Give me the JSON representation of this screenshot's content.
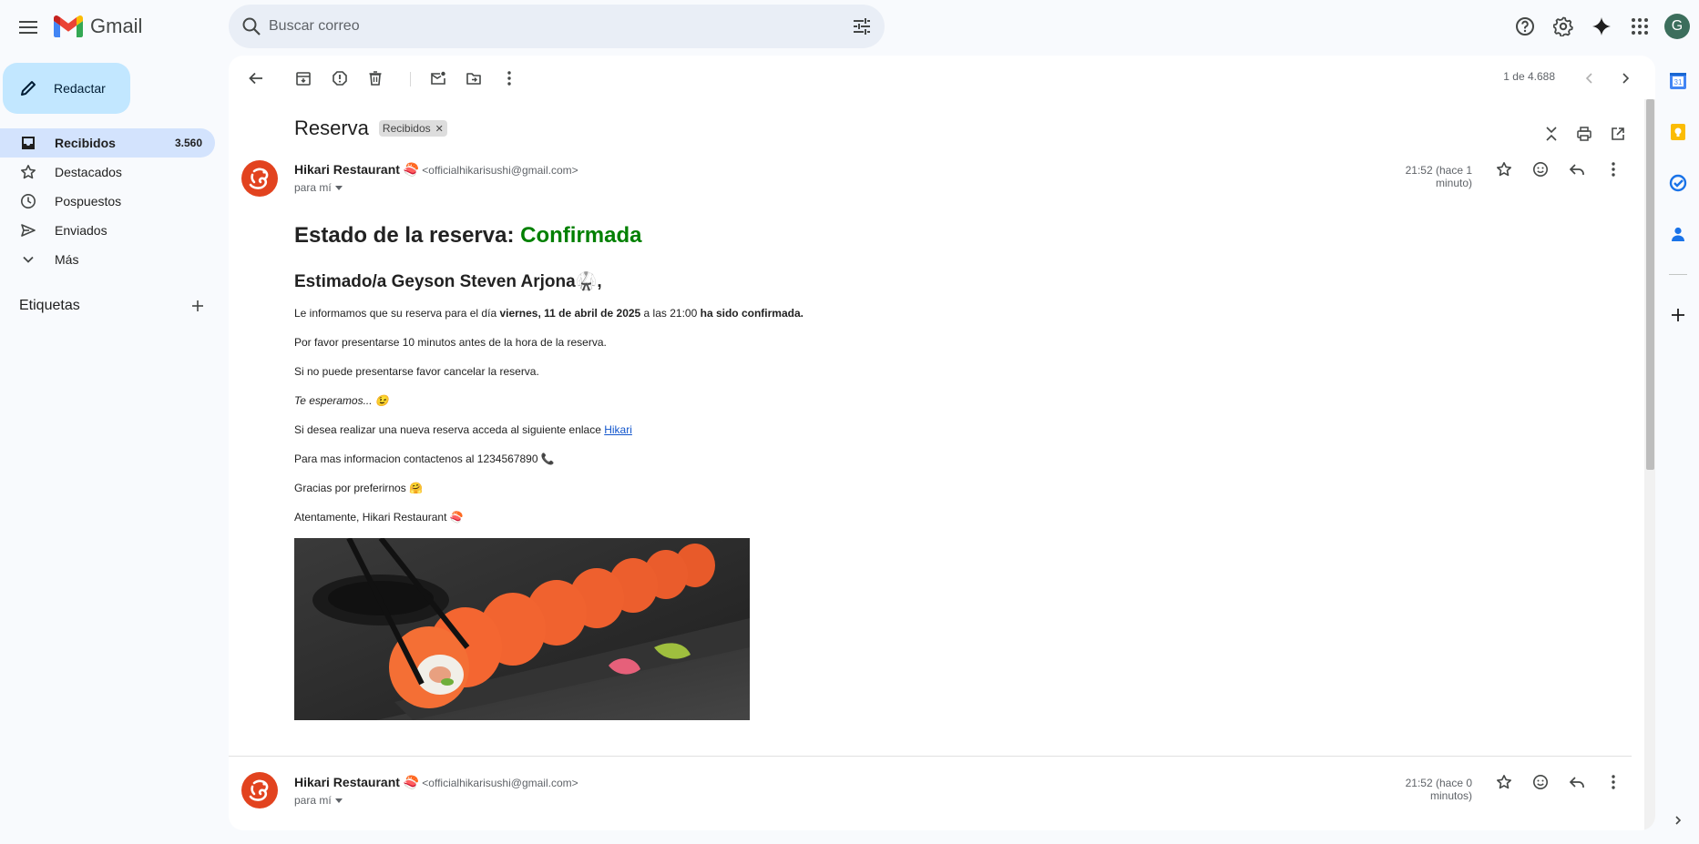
{
  "app": {
    "name": "Gmail"
  },
  "search": {
    "placeholder": "Buscar correo"
  },
  "header": {
    "avatar_letter": "G"
  },
  "compose": {
    "label": "Redactar"
  },
  "nav": {
    "items": [
      {
        "label": "Recibidos",
        "count": "3.560",
        "icon": "inbox-icon"
      },
      {
        "label": "Destacados",
        "count": "",
        "icon": "star-icon"
      },
      {
        "label": "Pospuestos",
        "count": "",
        "icon": "clock-icon"
      },
      {
        "label": "Enviados",
        "count": "",
        "icon": "send-icon"
      },
      {
        "label": "Más",
        "count": "",
        "icon": "chevron-down-icon"
      }
    ],
    "labels_title": "Etiquetas"
  },
  "toolbar": {
    "pager": "1 de 4.688"
  },
  "thread": {
    "subject": "Reserva",
    "chip": "Recibidos",
    "messages": [
      {
        "sender_name": "Hikari Restaurant 🍣",
        "sender_email": "<officialhikarisushi@gmail.com>",
        "to": "para mí",
        "time": "21:52 (hace 1 minuto)"
      },
      {
        "sender_name": "Hikari Restaurant 🍣",
        "sender_email": "<officialhikarisushi@gmail.com>",
        "to": "para mí",
        "time": "21:52 (hace 0 minutos)"
      }
    ]
  },
  "email": {
    "title_prefix": "Estado de la reserva: ",
    "title_status": "Confirmada",
    "greeting": "Estimado/a Geyson Steven Arjona🥋,",
    "p1_pre": "Le informamos que su reserva para el día ",
    "p1_date": "viernes, 11 de abril de 2025",
    "p1_mid": " a las 21:00 ",
    "p1_post": "ha sido confirmada.",
    "p2": "Por favor presentarse 10 minutos antes de la hora de la reserva.",
    "p3": "Si no puede presentarse favor cancelar la reserva.",
    "p4": "Te esperamos... 😉",
    "p5_pre": "Si desea realizar una nueva reserva acceda al siguiente enlace ",
    "p5_link": "Hikari",
    "p6": "Para mas informacion contactenos al 1234567890 📞",
    "p7": "Gracias por preferirnos 🤗",
    "p8": "Atentamente, Hikari Restaurant 🍣"
  },
  "colors": {
    "status_green": "#008000",
    "compose_bg": "#c2e7ff",
    "active_nav": "#d3e3fd",
    "brand_red": "#ea4335"
  }
}
